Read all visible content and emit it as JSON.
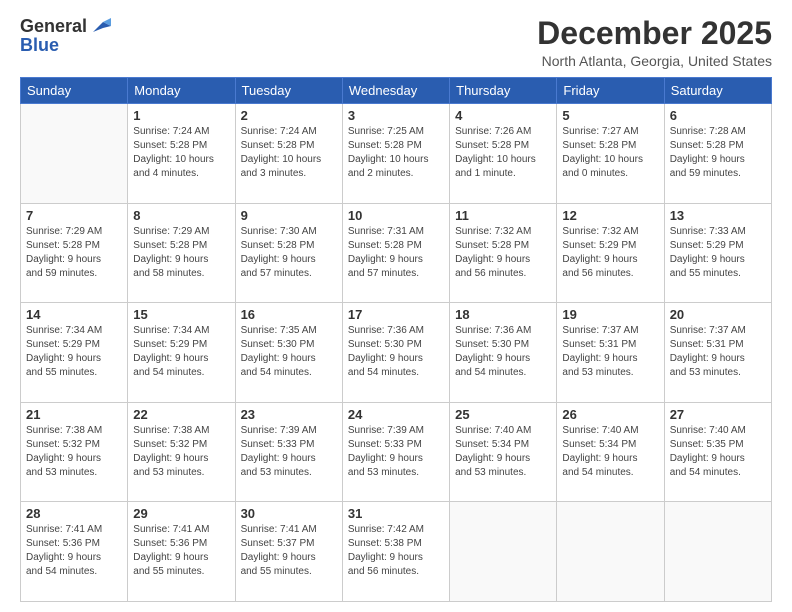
{
  "header": {
    "logo_line1": "General",
    "logo_line2": "Blue",
    "title": "December 2025",
    "subtitle": "North Atlanta, Georgia, United States"
  },
  "weekdays": [
    "Sunday",
    "Monday",
    "Tuesday",
    "Wednesday",
    "Thursday",
    "Friday",
    "Saturday"
  ],
  "weeks": [
    [
      {
        "day": "",
        "info": ""
      },
      {
        "day": "1",
        "info": "Sunrise: 7:24 AM\nSunset: 5:28 PM\nDaylight: 10 hours\nand 4 minutes."
      },
      {
        "day": "2",
        "info": "Sunrise: 7:24 AM\nSunset: 5:28 PM\nDaylight: 10 hours\nand 3 minutes."
      },
      {
        "day": "3",
        "info": "Sunrise: 7:25 AM\nSunset: 5:28 PM\nDaylight: 10 hours\nand 2 minutes."
      },
      {
        "day": "4",
        "info": "Sunrise: 7:26 AM\nSunset: 5:28 PM\nDaylight: 10 hours\nand 1 minute."
      },
      {
        "day": "5",
        "info": "Sunrise: 7:27 AM\nSunset: 5:28 PM\nDaylight: 10 hours\nand 0 minutes."
      },
      {
        "day": "6",
        "info": "Sunrise: 7:28 AM\nSunset: 5:28 PM\nDaylight: 9 hours\nand 59 minutes."
      }
    ],
    [
      {
        "day": "7",
        "info": "Sunrise: 7:29 AM\nSunset: 5:28 PM\nDaylight: 9 hours\nand 59 minutes."
      },
      {
        "day": "8",
        "info": "Sunrise: 7:29 AM\nSunset: 5:28 PM\nDaylight: 9 hours\nand 58 minutes."
      },
      {
        "day": "9",
        "info": "Sunrise: 7:30 AM\nSunset: 5:28 PM\nDaylight: 9 hours\nand 57 minutes."
      },
      {
        "day": "10",
        "info": "Sunrise: 7:31 AM\nSunset: 5:28 PM\nDaylight: 9 hours\nand 57 minutes."
      },
      {
        "day": "11",
        "info": "Sunrise: 7:32 AM\nSunset: 5:28 PM\nDaylight: 9 hours\nand 56 minutes."
      },
      {
        "day": "12",
        "info": "Sunrise: 7:32 AM\nSunset: 5:29 PM\nDaylight: 9 hours\nand 56 minutes."
      },
      {
        "day": "13",
        "info": "Sunrise: 7:33 AM\nSunset: 5:29 PM\nDaylight: 9 hours\nand 55 minutes."
      }
    ],
    [
      {
        "day": "14",
        "info": "Sunrise: 7:34 AM\nSunset: 5:29 PM\nDaylight: 9 hours\nand 55 minutes."
      },
      {
        "day": "15",
        "info": "Sunrise: 7:34 AM\nSunset: 5:29 PM\nDaylight: 9 hours\nand 54 minutes."
      },
      {
        "day": "16",
        "info": "Sunrise: 7:35 AM\nSunset: 5:30 PM\nDaylight: 9 hours\nand 54 minutes."
      },
      {
        "day": "17",
        "info": "Sunrise: 7:36 AM\nSunset: 5:30 PM\nDaylight: 9 hours\nand 54 minutes."
      },
      {
        "day": "18",
        "info": "Sunrise: 7:36 AM\nSunset: 5:30 PM\nDaylight: 9 hours\nand 54 minutes."
      },
      {
        "day": "19",
        "info": "Sunrise: 7:37 AM\nSunset: 5:31 PM\nDaylight: 9 hours\nand 53 minutes."
      },
      {
        "day": "20",
        "info": "Sunrise: 7:37 AM\nSunset: 5:31 PM\nDaylight: 9 hours\nand 53 minutes."
      }
    ],
    [
      {
        "day": "21",
        "info": "Sunrise: 7:38 AM\nSunset: 5:32 PM\nDaylight: 9 hours\nand 53 minutes."
      },
      {
        "day": "22",
        "info": "Sunrise: 7:38 AM\nSunset: 5:32 PM\nDaylight: 9 hours\nand 53 minutes."
      },
      {
        "day": "23",
        "info": "Sunrise: 7:39 AM\nSunset: 5:33 PM\nDaylight: 9 hours\nand 53 minutes."
      },
      {
        "day": "24",
        "info": "Sunrise: 7:39 AM\nSunset: 5:33 PM\nDaylight: 9 hours\nand 53 minutes."
      },
      {
        "day": "25",
        "info": "Sunrise: 7:40 AM\nSunset: 5:34 PM\nDaylight: 9 hours\nand 53 minutes."
      },
      {
        "day": "26",
        "info": "Sunrise: 7:40 AM\nSunset: 5:34 PM\nDaylight: 9 hours\nand 54 minutes."
      },
      {
        "day": "27",
        "info": "Sunrise: 7:40 AM\nSunset: 5:35 PM\nDaylight: 9 hours\nand 54 minutes."
      }
    ],
    [
      {
        "day": "28",
        "info": "Sunrise: 7:41 AM\nSunset: 5:36 PM\nDaylight: 9 hours\nand 54 minutes."
      },
      {
        "day": "29",
        "info": "Sunrise: 7:41 AM\nSunset: 5:36 PM\nDaylight: 9 hours\nand 55 minutes."
      },
      {
        "day": "30",
        "info": "Sunrise: 7:41 AM\nSunset: 5:37 PM\nDaylight: 9 hours\nand 55 minutes."
      },
      {
        "day": "31",
        "info": "Sunrise: 7:42 AM\nSunset: 5:38 PM\nDaylight: 9 hours\nand 56 minutes."
      },
      {
        "day": "",
        "info": ""
      },
      {
        "day": "",
        "info": ""
      },
      {
        "day": "",
        "info": ""
      }
    ]
  ]
}
